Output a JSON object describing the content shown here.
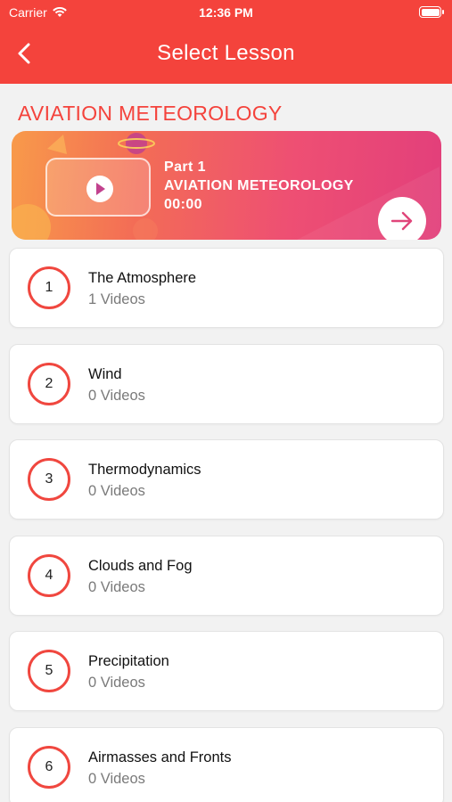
{
  "status_bar": {
    "carrier": "Carrier",
    "time": "12:36 PM"
  },
  "header": {
    "title": "Select Lesson"
  },
  "section_title": "AVIATION METEOROLOGY",
  "banner": {
    "part": "Part 1",
    "title": "AVIATION METEOROLOGY",
    "duration": "00:00"
  },
  "lessons": [
    {
      "number": "1",
      "title": "The Atmosphere",
      "count": "1 Videos"
    },
    {
      "number": "2",
      "title": "Wind",
      "count": "0 Videos"
    },
    {
      "number": "3",
      "title": "Thermodynamics",
      "count": "0 Videos"
    },
    {
      "number": "4",
      "title": "Clouds and Fog",
      "count": "0 Videos"
    },
    {
      "number": "5",
      "title": "Precipitation",
      "count": "0 Videos"
    },
    {
      "number": "6",
      "title": "Airmasses and Fronts",
      "count": "0 Videos"
    }
  ],
  "colors": {
    "accent": "#f4433c",
    "banner_start": "#f89a4a",
    "banner_end": "#e23f7b"
  },
  "icons": {
    "back": "chevron-left-icon",
    "wifi": "wifi-icon",
    "battery": "battery-icon",
    "play": "play-icon",
    "arrow": "arrow-right-icon"
  }
}
